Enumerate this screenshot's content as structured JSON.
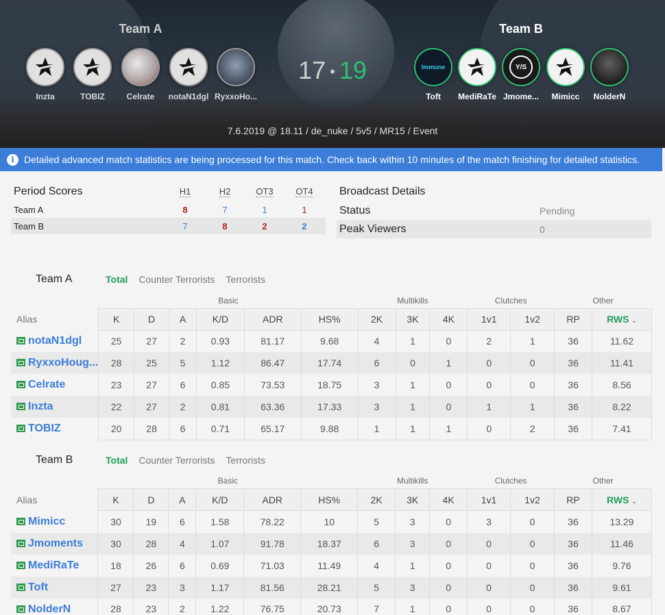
{
  "header": {
    "team_a": "Team A",
    "team_b": "Team B",
    "score_a": "17",
    "score_sep": "•",
    "score_b": "19",
    "match_info": "7.6.2019 @ 18.11 / de_nuke / 5v5 / MR15 / Event",
    "team_a_players": [
      "Inzta",
      "TOBIZ",
      "Celrate",
      "notaN1dgl",
      "RyxxoHo..."
    ],
    "team_b_players": [
      "Toft",
      "MediRaTe",
      "Jmome...",
      "Mimicc",
      "NolderN"
    ],
    "immune_label": "Immune",
    "ys_label": "Y/S"
  },
  "notice": {
    "text": "Detailed advanced match statistics are being processed for this match. Check back within 10 minutes of the match finishing for detailed statistics."
  },
  "period": {
    "title": "Period Scores",
    "columns": [
      "H1",
      "H2",
      "OT3",
      "OT4"
    ],
    "rows": [
      {
        "team": "Team A",
        "values": [
          "8",
          "7",
          "1",
          "1"
        ]
      },
      {
        "team": "Team B",
        "values": [
          "7",
          "8",
          "2",
          "2"
        ]
      }
    ]
  },
  "broadcast": {
    "title": "Broadcast Details",
    "status_label": "Status",
    "status_value": "Pending",
    "viewers_label": "Peak Viewers",
    "viewers_value": "0"
  },
  "tabs": {
    "total": "Total",
    "ct": "Counter Terrorists",
    "t": "Terrorists"
  },
  "groups": {
    "basic": "Basic",
    "multikills": "Multikills",
    "clutches": "Clutches",
    "other": "Other"
  },
  "columns": [
    "Alias",
    "K",
    "D",
    "A",
    "K/D",
    "ADR",
    "HS%",
    "2K",
    "3K",
    "4K",
    "1v1",
    "1v2",
    "RP",
    "RWS"
  ],
  "rws_caret": "⌄",
  "team_a_stats": [
    [
      "notaN1dgl",
      "25",
      "27",
      "2",
      "0.93",
      "81.17",
      "9.68",
      "4",
      "1",
      "0",
      "2",
      "1",
      "36",
      "11.62"
    ],
    [
      "RyxxoHoug...",
      "28",
      "25",
      "5",
      "1.12",
      "86.47",
      "17.74",
      "6",
      "0",
      "1",
      "0",
      "0",
      "36",
      "11.41"
    ],
    [
      "Celrate",
      "23",
      "27",
      "6",
      "0.85",
      "73.53",
      "18.75",
      "3",
      "1",
      "0",
      "0",
      "0",
      "36",
      "8.56"
    ],
    [
      "Inzta",
      "22",
      "27",
      "2",
      "0.81",
      "63.36",
      "17.33",
      "3",
      "1",
      "0",
      "1",
      "1",
      "36",
      "8.22"
    ],
    [
      "TOBIZ",
      "20",
      "28",
      "6",
      "0.71",
      "65.17",
      "9.88",
      "1",
      "1",
      "1",
      "0",
      "2",
      "36",
      "7.41"
    ]
  ],
  "team_b_stats": [
    [
      "Mimicc",
      "30",
      "19",
      "6",
      "1.58",
      "78.22",
      "10",
      "5",
      "3",
      "0",
      "3",
      "0",
      "36",
      "13.29"
    ],
    [
      "Jmoments",
      "30",
      "28",
      "4",
      "1.07",
      "91.78",
      "18.37",
      "6",
      "3",
      "0",
      "0",
      "0",
      "36",
      "11.46"
    ],
    [
      "MediRaTe",
      "18",
      "26",
      "6",
      "0.69",
      "71.03",
      "11.49",
      "4",
      "1",
      "0",
      "0",
      "0",
      "36",
      "9.76"
    ],
    [
      "Toft",
      "27",
      "23",
      "3",
      "1.17",
      "81.56",
      "28.21",
      "5",
      "3",
      "0",
      "0",
      "0",
      "36",
      "9.61"
    ],
    [
      "NolderN",
      "28",
      "23",
      "2",
      "1.22",
      "76.75",
      "20.73",
      "7",
      "1",
      "0",
      "0",
      "0",
      "36",
      "8.67"
    ]
  ]
}
